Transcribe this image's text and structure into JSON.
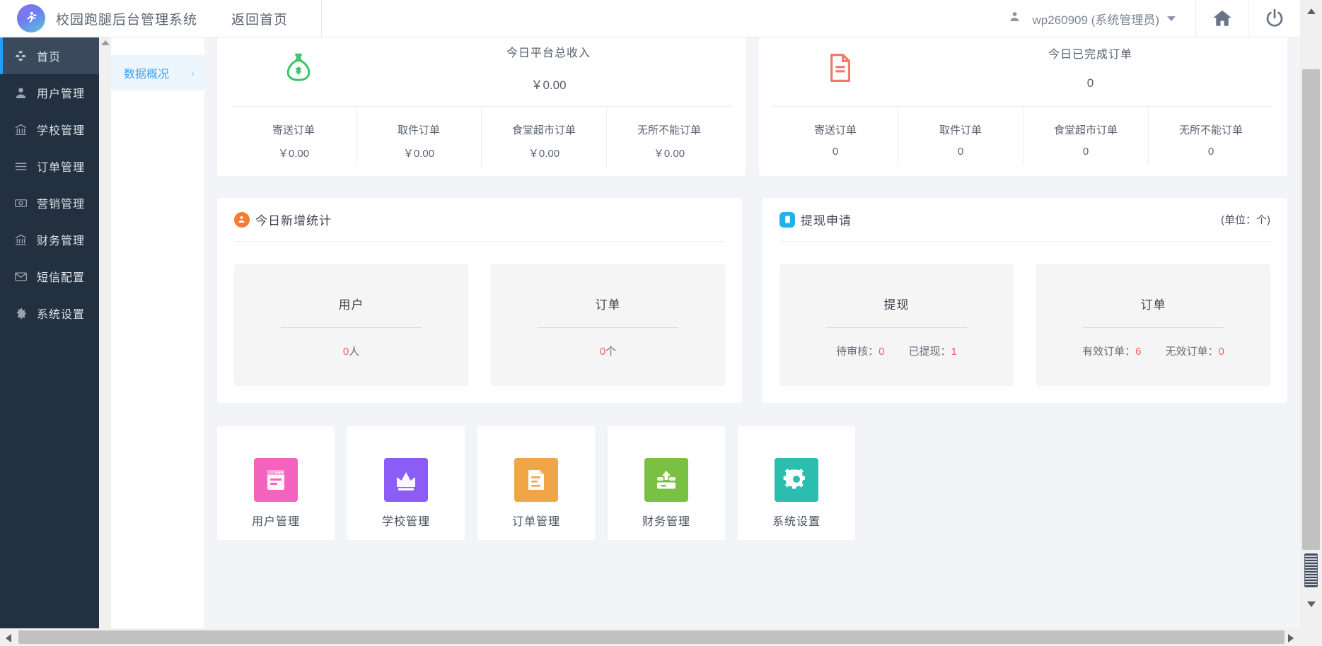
{
  "header": {
    "brand_title": "校园跑腿后台管理系统",
    "home_link": "返回首页",
    "user_name": "wp260909 (系统管理员)",
    "home_button_name": "home",
    "power_button_name": "logout"
  },
  "sidebar": {
    "items": [
      {
        "label": "首页",
        "icon": "cubes-icon",
        "active": true
      },
      {
        "label": "用户管理",
        "icon": "user-icon",
        "active": false
      },
      {
        "label": "学校管理",
        "icon": "bank-icon",
        "active": false
      },
      {
        "label": "订单管理",
        "icon": "list-icon",
        "active": false
      },
      {
        "label": "营销管理",
        "icon": "money-icon",
        "active": false
      },
      {
        "label": "财务管理",
        "icon": "bank-icon",
        "active": false
      },
      {
        "label": "短信配置",
        "icon": "envelope-icon",
        "active": false
      },
      {
        "label": "系统设置",
        "icon": "gear-icon",
        "active": false
      }
    ]
  },
  "submenu": {
    "items": [
      {
        "label": "数据概况",
        "chevron": "›"
      }
    ]
  },
  "main": {
    "top_cards": [
      {
        "icon": "money-bag-icon",
        "icon_color": "#3ac46a",
        "title": "今日平台总收入",
        "value": "￥0.00",
        "columns": [
          {
            "label": "寄送订单",
            "value": "￥0.00"
          },
          {
            "label": "取件订单",
            "value": "￥0.00"
          },
          {
            "label": "食堂超市订单",
            "value": "￥0.00"
          },
          {
            "label": "无所不能订单",
            "value": "￥0.00"
          }
        ]
      },
      {
        "icon": "document-icon",
        "icon_color": "#f2796b",
        "title": "今日已完成订单",
        "value": "0",
        "columns": [
          {
            "label": "寄送订单",
            "value": "0"
          },
          {
            "label": "取件订单",
            "value": "0"
          },
          {
            "label": "食堂超市订单",
            "value": "0"
          },
          {
            "label": "无所不能订单",
            "value": "0"
          }
        ]
      }
    ],
    "panels": [
      {
        "title": "今日新增统计",
        "icon": "user-add-icon",
        "icon_color": "#f57c32",
        "unit": "",
        "boxes": [
          {
            "title": "用户",
            "stats": [
              {
                "label": "",
                "value": "0",
                "suffix": "人"
              }
            ]
          },
          {
            "title": "订单",
            "stats": [
              {
                "label": "",
                "value": "0",
                "suffix": "个"
              }
            ]
          }
        ]
      },
      {
        "title": "提现申请",
        "icon": "withdraw-icon",
        "icon_color": "#21b0eb",
        "unit": "(单位：个)",
        "boxes": [
          {
            "title": "提现",
            "stats": [
              {
                "label": "待审核：",
                "value": "0",
                "suffix": ""
              },
              {
                "label": "已提现：",
                "value": "1",
                "suffix": ""
              }
            ]
          },
          {
            "title": "订单",
            "stats": [
              {
                "label": "有效订单：",
                "value": "6",
                "suffix": ""
              },
              {
                "label": "无效订单：",
                "value": "0",
                "suffix": ""
              }
            ]
          }
        ]
      }
    ],
    "shortcuts": [
      {
        "label": "用户管理",
        "icon": "user-card-icon",
        "color": "#f463bd"
      },
      {
        "label": "学校管理",
        "icon": "crown-icon",
        "color": "#8b5cf6"
      },
      {
        "label": "订单管理",
        "icon": "order-doc-icon",
        "color": "#f0a548"
      },
      {
        "label": "财务管理",
        "icon": "upload-card-icon",
        "color": "#7ac043"
      },
      {
        "label": "系统设置",
        "icon": "gear-icon",
        "color": "#2bbdad"
      }
    ]
  },
  "colors": {
    "accent": "#1e9fff",
    "sidebar_bg": "#22303f",
    "sidebar_active": "#3a4a5c",
    "red_number": "#f0605c"
  }
}
